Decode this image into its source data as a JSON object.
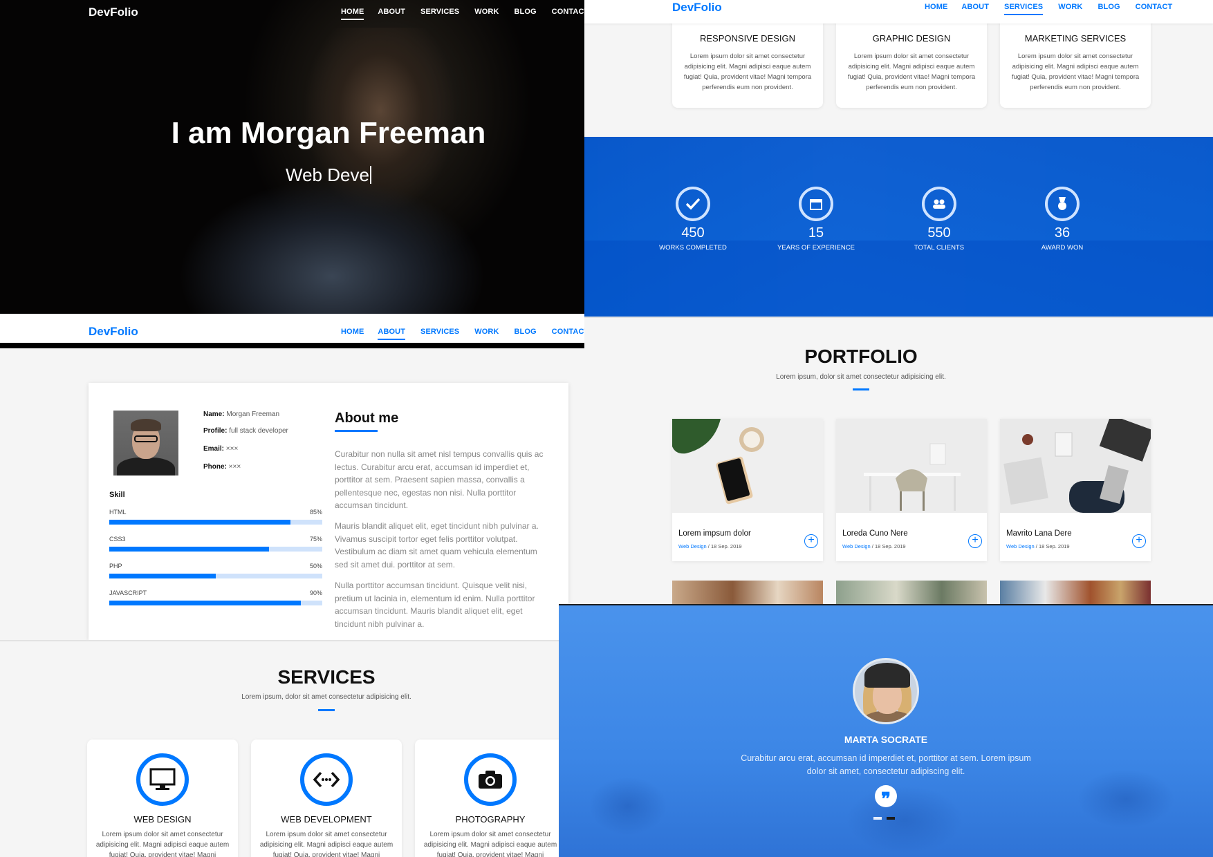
{
  "brand": "DevFolio",
  "nav": {
    "items": [
      "HOME",
      "ABOUT",
      "SERVICES",
      "WORK",
      "BLOG",
      "CONTACT"
    ]
  },
  "colors": {
    "primary": "#0078ff",
    "background": "#f5f5f5",
    "hero_bg": "#050404"
  },
  "hero": {
    "title": "I am Morgan Freeman",
    "typed_text": "Web Deve"
  },
  "about": {
    "name_label": "Name:",
    "name": "Morgan Freeman",
    "profile_label": "Profile:",
    "profile": "full stack developer",
    "email_label": "Email:",
    "email": "×××",
    "phone_label": "Phone:",
    "phone": "×××",
    "skill_title": "Skill",
    "skills": [
      {
        "name": "HTML",
        "percent_label": "85%",
        "percent": 85
      },
      {
        "name": "CSS3",
        "percent_label": "75%",
        "percent": 75
      },
      {
        "name": "PHP",
        "percent_label": "50%",
        "percent": 50
      },
      {
        "name": "JAVASCRIPT",
        "percent_label": "90%",
        "percent": 90
      }
    ],
    "heading": "About me",
    "paragraphs": [
      "Curabitur non nulla sit amet nisl tempus convallis quis ac lectus. Curabitur arcu erat, accumsan id imperdiet et, porttitor at sem. Praesent sapien massa, convallis a pellentesque nec, egestas non nisi. Nulla porttitor accumsan tincidunt.",
      "Mauris blandit aliquet elit, eget tincidunt nibh pulvinar a. Vivamus suscipit tortor eget felis porttitor volutpat. Vestibulum ac diam sit amet quam vehicula elementum sed sit amet dui. porttitor at sem.",
      "Nulla porttitor accumsan tincidunt. Quisque velit nisi, pretium ut lacinia in, elementum id enim. Nulla porttitor accumsan tincidunt. Mauris blandit aliquet elit, eget tincidunt nibh pulvinar a."
    ]
  },
  "services": {
    "title": "SERVICES",
    "subtitle": "Lorem ipsum, dolor sit amet consectetur adipisicing elit.",
    "items": [
      {
        "name": "WEB DESIGN",
        "icon": "monitor-icon",
        "desc": "Lorem ipsum dolor sit amet consectetur adipisicing elit. Magni adipisci eaque autem fugiat! Quia, provident vitae! Magni"
      },
      {
        "name": "WEB DEVELOPMENT",
        "icon": "code-icon",
        "desc": "Lorem ipsum dolor sit amet consectetur adipisicing elit. Magni adipisci eaque autem fugiat! Quia, provident vitae! Magni"
      },
      {
        "name": "PHOTOGRAPHY",
        "icon": "camera-icon",
        "desc": "Lorem ipsum dolor sit amet consectetur adipisicing elit. Magni adipisci eaque autem fugiat! Quia, provident vitae! Magni"
      }
    ],
    "more": [
      {
        "name": "RESPONSIVE DESIGN",
        "desc": "Lorem ipsum dolor sit amet consectetur adipisicing elit. Magni adipisci eaque autem fugiat! Quia, provident vitae! Magni tempora perferendis eum non provident."
      },
      {
        "name": "GRAPHIC DESIGN",
        "desc": "Lorem ipsum dolor sit amet consectetur adipisicing elit. Magni adipisci eaque autem fugiat! Quia, provident vitae! Magni tempora perferendis eum non provident."
      },
      {
        "name": "MARKETING SERVICES",
        "desc": "Lorem ipsum dolor sit amet consectetur adipisicing elit. Magni adipisci eaque autem fugiat! Quia, provident vitae! Magni tempora perferendis eum non provident."
      }
    ]
  },
  "counters": [
    {
      "value": "450",
      "label": "WORKS COMPLETED",
      "icon": "check-icon"
    },
    {
      "value": "15",
      "label": "YEARS OF EXPERIENCE",
      "icon": "calendar-icon"
    },
    {
      "value": "550",
      "label": "TOTAL CLIENTS",
      "icon": "people-icon"
    },
    {
      "value": "36",
      "label": "AWARD WON",
      "icon": "medal-icon"
    }
  ],
  "portfolio": {
    "title": "PORTFOLIO",
    "subtitle": "Lorem ipsum, dolor sit amet consectetur adipisicing elit.",
    "items": [
      {
        "title": "Lorem impsum dolor",
        "category": "Web Design",
        "date": " / 18 Sep. 2019"
      },
      {
        "title": "Loreda Cuno Nere",
        "category": "Web Design",
        "date": " / 18 Sep. 2019"
      },
      {
        "title": "Mavrito Lana Dere",
        "category": "Web Design",
        "date": " / 18 Sep. 2019"
      }
    ]
  },
  "testimonial": {
    "name": "MARTA SOCRATE",
    "quote": "Curabitur arcu erat, accumsan id imperdiet et, porttitor at sem. Lorem ipsum dolor sit amet, consectetur adipiscing elit."
  }
}
